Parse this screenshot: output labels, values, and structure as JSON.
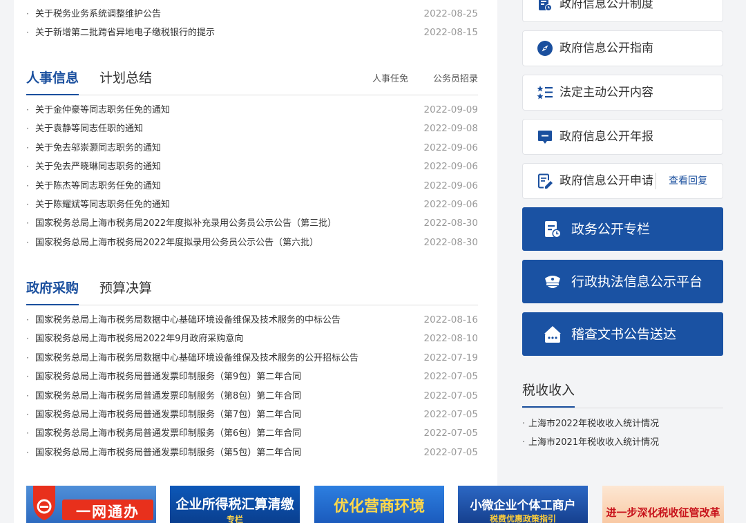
{
  "top_news": [
    {
      "title": "关于税务业务系统调整维护公告",
      "date": "2022-08-25"
    },
    {
      "title": "关于新增第二批跨省异地电子缴税银行的提示",
      "date": "2022-08-15"
    }
  ],
  "personnel": {
    "tabs": [
      "人事信息",
      "计划总结"
    ],
    "links": [
      "人事任免",
      "公务员招录"
    ],
    "items": [
      {
        "title": "关于金仲豪等同志职务任免的通知",
        "date": "2022-09-09"
      },
      {
        "title": "关于袁静等同志任职的通知",
        "date": "2022-09-08"
      },
      {
        "title": "关于免去邬崇灏同志职务的通知",
        "date": "2022-09-06"
      },
      {
        "title": "关于免去严晓琳同志职务的通知",
        "date": "2022-09-06"
      },
      {
        "title": "关于陈杰等同志职务任免的通知",
        "date": "2022-09-06"
      },
      {
        "title": "关于陈耀斌等同志职务任免的通知",
        "date": "2022-09-06"
      },
      {
        "title": "国家税务总局上海市税务局2022年度拟补充录用公务员公示公告（第三批）",
        "date": "2022-08-30"
      },
      {
        "title": "国家税务总局上海市税务局2022年度拟录用公务员公示公告（第六批）",
        "date": "2022-08-30"
      }
    ]
  },
  "procurement": {
    "tabs": [
      "政府采购",
      "预算决算"
    ],
    "items": [
      {
        "title": "国家税务总局上海市税务局数据中心基础环境设备维保及技术服务的中标公告",
        "date": "2022-08-16"
      },
      {
        "title": "国家税务总局上海市税务局2022年9月政府采购意向",
        "date": "2022-08-10"
      },
      {
        "title": "国家税务总局上海市税务局数据中心基础环境设备维保及技术服务的公开招标公告",
        "date": "2022-07-19"
      },
      {
        "title": "国家税务总局上海市税务局普通发票印制服务（第9包）第二年合同",
        "date": "2022-07-05"
      },
      {
        "title": "国家税务总局上海市税务局普通发票印制服务（第8包）第二年合同",
        "date": "2022-07-05"
      },
      {
        "title": "国家税务总局上海市税务局普通发票印制服务（第7包）第二年合同",
        "date": "2022-07-05"
      },
      {
        "title": "国家税务总局上海市税务局普通发票印制服务（第6包）第二年合同",
        "date": "2022-07-05"
      },
      {
        "title": "国家税务总局上海市税务局普通发票印制服务（第5包）第二年合同",
        "date": "2022-07-05"
      }
    ]
  },
  "sidebar": {
    "buttons": [
      {
        "label": "政府信息公开制度",
        "icon": "document-icon"
      },
      {
        "label": "政府信息公开指南",
        "icon": "compass-icon"
      },
      {
        "label": "法定主动公开内容",
        "icon": "list-icon"
      },
      {
        "label": "政府信息公开年报",
        "icon": "chat-icon"
      },
      {
        "label": "政府信息公开申请",
        "icon": "edit-icon",
        "extra": "查看回复"
      }
    ],
    "blue_buttons": [
      {
        "label": "政务公开专栏",
        "icon": "file-clock-icon"
      },
      {
        "label": "行政执法信息公示平台",
        "icon": "police-cap-icon"
      },
      {
        "label": "稽查文书公告送达",
        "icon": "robot-icon"
      }
    ],
    "tax_income": {
      "title": "税收收入",
      "items": [
        "上海市2022年税收收入统计情况",
        "上海市2021年税收收入统计情况"
      ]
    }
  },
  "banners": [
    {
      "title": "一网通办",
      "subtitle": ""
    },
    {
      "title": "企业所得税汇算清缴",
      "subtitle": "专栏"
    },
    {
      "title": "优化营商环境",
      "subtitle": ""
    },
    {
      "title": "小微企业个体工商户",
      "subtitle": "税费优惠政策指引"
    },
    {
      "title": "进一步深化税收征管改革",
      "subtitle": ""
    }
  ],
  "colors": {
    "accent": "#1a4f9e",
    "button_blue": "#1a52a3"
  }
}
